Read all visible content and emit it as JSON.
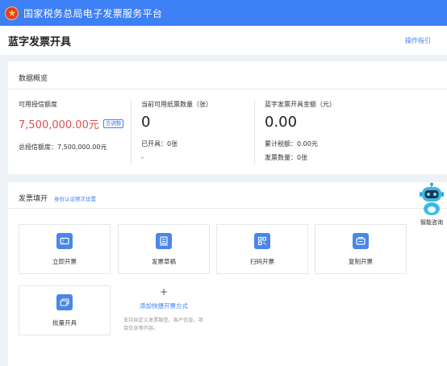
{
  "topbar": {
    "title": "国家税务总局电子发票服务平台",
    "emblem_icon": "tax-emblem-icon"
  },
  "header": {
    "title": "蓝字发票开具",
    "help_link": "操作指引"
  },
  "overview": {
    "title": "数据概览",
    "credit": {
      "label": "可用授信额度",
      "value": "7,500,000.00元",
      "adjust_button": "去调整",
      "total_label": "总授信额度：",
      "total_value": "7,500,000.00元"
    },
    "paper": {
      "label": "当前可用纸票数量（张）",
      "value": "0",
      "issued_label": "已开具：",
      "issued_value": "0张",
      "dash": "-"
    },
    "amount": {
      "label": "蓝字发票开具金额（元）",
      "value": "0.00",
      "tax_label": "累计税额：",
      "tax_value": "0.00元",
      "count_label": "发票数量：",
      "count_value": "0张"
    }
  },
  "fill": {
    "title": "发票填开",
    "verify_link": "身份认证频次设置",
    "cards": [
      {
        "label": "立即开票",
        "icon": "ticket-icon"
      },
      {
        "label": "发票草稿",
        "icon": "draft-icon"
      },
      {
        "label": "扫码开票",
        "icon": "qr-code-icon"
      },
      {
        "label": "复制开票",
        "icon": "copy-icon"
      },
      {
        "label": "批量开具",
        "icon": "batch-icon"
      }
    ],
    "add": {
      "plus": "+",
      "label": "添加快捷开票方式",
      "desc": "支持自定义发票類型、客户信息、项目信息等内容。"
    }
  },
  "assistant": {
    "label": "智能咨询",
    "icon": "robot-icon"
  },
  "colors": {
    "brand_blue": "#3d7ff5",
    "accent_red": "#d9534f",
    "icon_blue": "#4a86e8"
  }
}
